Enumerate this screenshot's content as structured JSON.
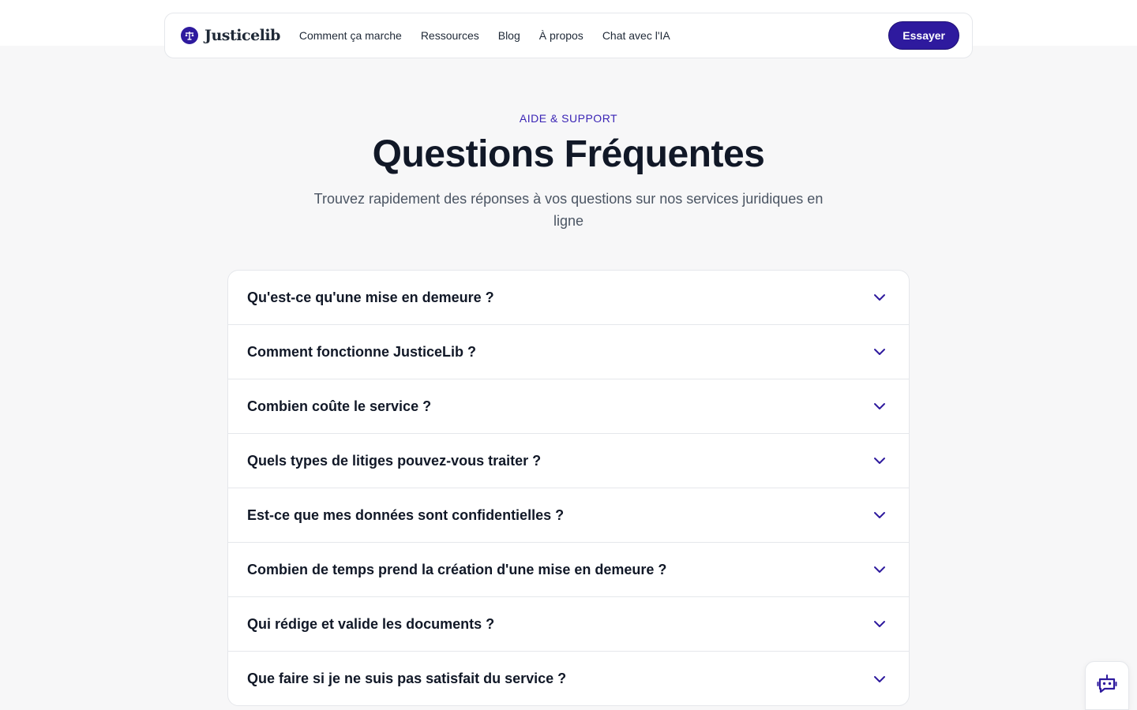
{
  "nav": {
    "brand": "Justicelib",
    "links": [
      "Comment ça marche",
      "Ressources",
      "Blog",
      "À propos",
      "Chat avec l'IA"
    ],
    "cta": "Essayer"
  },
  "hero": {
    "eyebrow": "AIDE & SUPPORT",
    "title": "Questions Fréquentes",
    "subtitle": "Trouvez rapidement des réponses à vos questions sur nos services juridiques en ligne"
  },
  "faq": [
    {
      "question": "Qu'est-ce qu'une mise en demeure ?"
    },
    {
      "question": "Comment fonctionne JusticeLib ?"
    },
    {
      "question": "Combien coûte le service ?"
    },
    {
      "question": "Quels types de litiges pouvez-vous traiter ?"
    },
    {
      "question": "Est-ce que mes données sont confidentielles ?"
    },
    {
      "question": "Combien de temps prend la création d'une mise en demeure ?"
    },
    {
      "question": "Qui rédige et valide les documents ?"
    },
    {
      "question": "Que faire si je ne suis pas satisfait du service ?"
    }
  ],
  "icons": {
    "logo": "scales-icon",
    "faq_toggle": "chevron-down-icon",
    "chat": "chatbot-icon"
  },
  "colors": {
    "accent": "#2e1a9e",
    "eyebrow": "#3a24b5",
    "background": "#f7f7f8"
  }
}
